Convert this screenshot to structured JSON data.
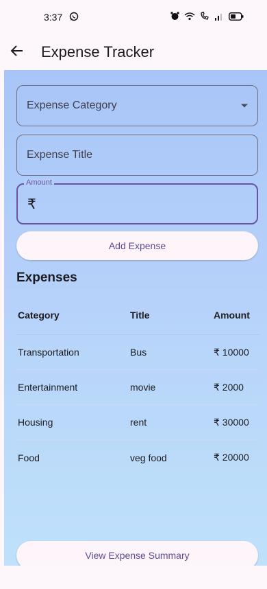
{
  "status_bar": {
    "time": "3:37",
    "icons": [
      "whatsapp-icon",
      "alarm-icon",
      "wifi-icon",
      "volte-icon",
      "signal-icon",
      "battery-icon"
    ]
  },
  "app_bar": {
    "title": "Expense Tracker",
    "back_icon": "arrow-left-icon"
  },
  "form": {
    "category": {
      "placeholder": "Expense Category",
      "value": ""
    },
    "title": {
      "placeholder": "Expense Title",
      "value": ""
    },
    "amount": {
      "label": "Amount",
      "prefix": "₹",
      "value": ""
    },
    "add_button_label": "Add Expense"
  },
  "expenses": {
    "heading": "Expenses",
    "columns": [
      "Category",
      "Title",
      "Amount"
    ],
    "rows": [
      {
        "category": "Transportation",
        "title": "Bus",
        "amount": "₹ 10000"
      },
      {
        "category": "Entertainment",
        "title": "movie",
        "amount": "₹ 2000"
      },
      {
        "category": "Housing",
        "title": "rent",
        "amount": "₹ 30000"
      },
      {
        "category": "Food",
        "title": "veg food",
        "amount": "₹ 20000"
      }
    ]
  },
  "summary_button_label": "View Expense Summary",
  "colors": {
    "accent": "#6a52a3",
    "button_text": "#5d4a92",
    "background_top": "#a9c5f8",
    "background_bottom": "#bfe1fb"
  }
}
